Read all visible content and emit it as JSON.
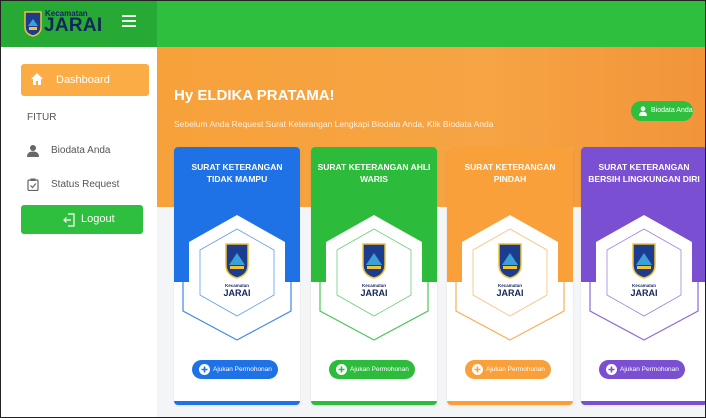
{
  "brand": {
    "small": "Kecamatan",
    "big": "JARAI"
  },
  "sidebar": {
    "dashboard": "Dashboard",
    "section": "FITUR",
    "items": [
      {
        "label": "Biodata Anda",
        "icon": "user-icon"
      },
      {
        "label": "Status Request",
        "icon": "checklist-icon"
      }
    ],
    "logout": "Logout"
  },
  "hero": {
    "greeting": "Hy ELDIKA PRATAMA!",
    "subtitle": "Sebelum Anda Request Surat Keterangan Lengkapi Biodata Anda, Klik Biodata Anda",
    "biodata_button": "Biodata Anda"
  },
  "cards": [
    {
      "title": "SURAT KETERANGAN TIDAK MAMPU",
      "button": "Ajukan Permohonan",
      "color": "#1f72e6",
      "emblem_small": "Kecamatan",
      "emblem_big": "JARAI"
    },
    {
      "title": "SURAT KETERANGAN AHLI WARIS",
      "button": "Ajukan Permohonan",
      "color": "#2dbb3c",
      "emblem_small": "Kecamatan",
      "emblem_big": "JARAI"
    },
    {
      "title": "SURAT KETERANGAN PINDAH",
      "button": "Ajukan Permohonan",
      "color": "#f9a03a",
      "emblem_small": "Kecamatan",
      "emblem_big": "JARAI"
    },
    {
      "title": "SURAT KETERANGAN BERSIH LINGKUNGAN DIRI",
      "button": "Ajukan Permohonan",
      "color": "#7a4fd1",
      "emblem_small": "Kecamatan",
      "emblem_big": "JARAI"
    }
  ],
  "colors": {
    "topbar": "#2fbf3f",
    "accent": "#fbac45"
  }
}
